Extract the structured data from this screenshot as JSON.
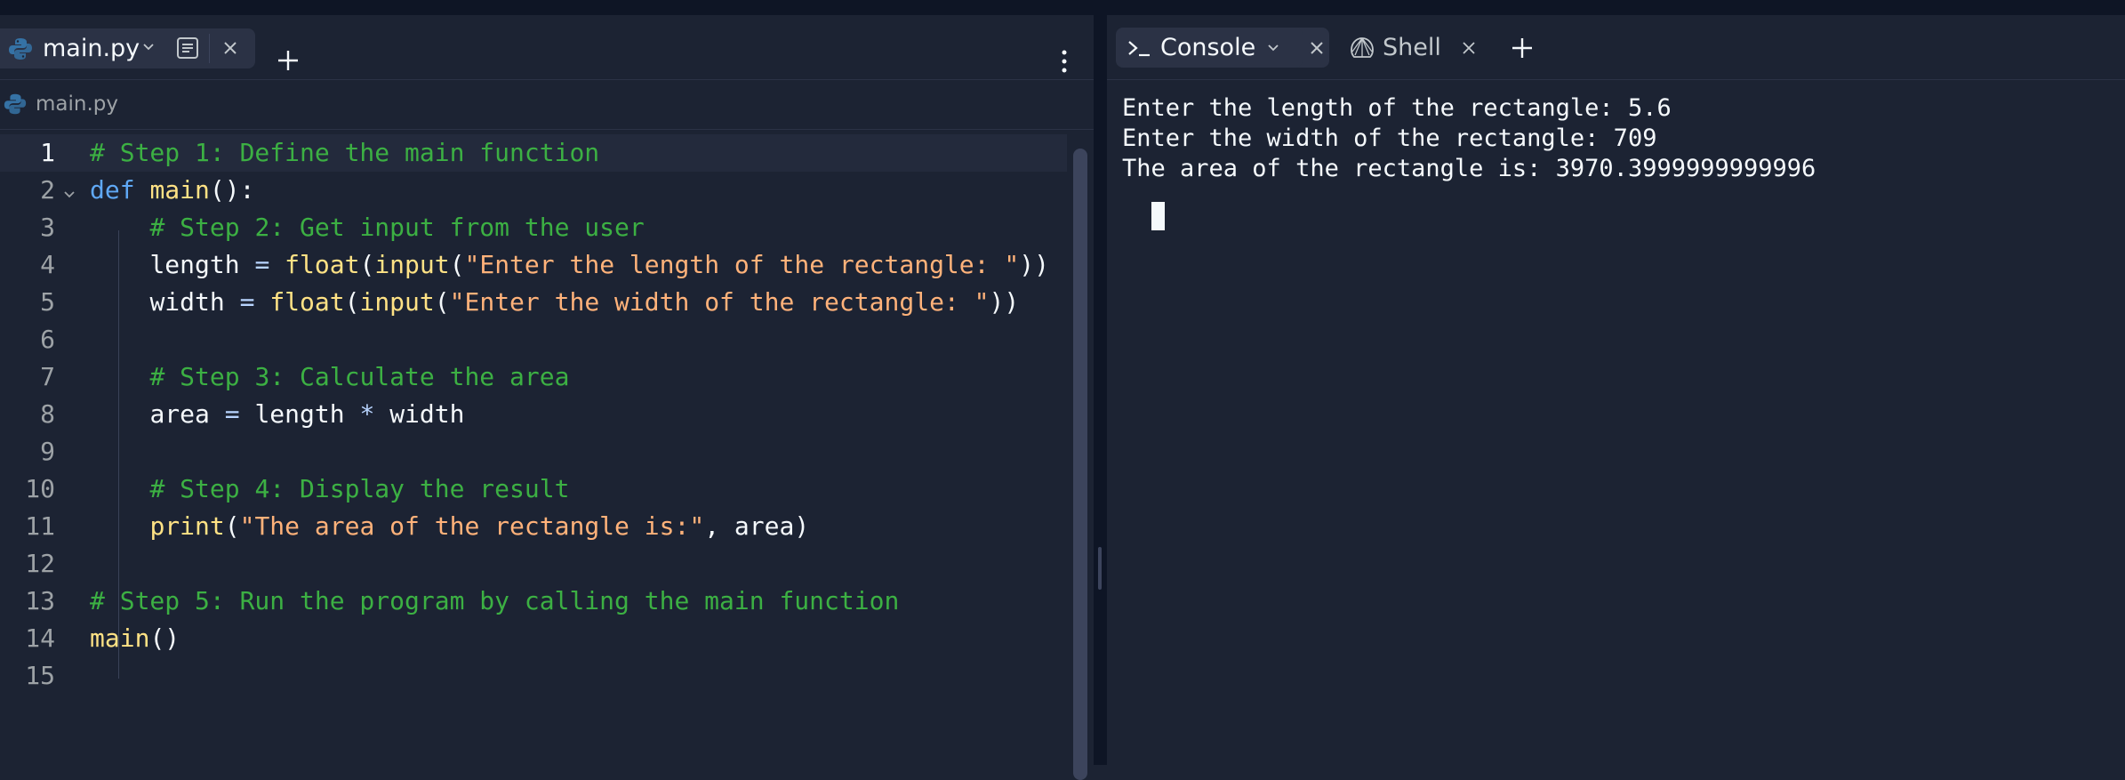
{
  "editor_tab": {
    "filename": "main.py"
  },
  "breadcrumb": {
    "filename": "main.py"
  },
  "code_lines": [
    {
      "n": "1",
      "tokens": [
        [
          "cm",
          "# Step 1: Define the main function"
        ]
      ]
    },
    {
      "n": "2",
      "tokens": [
        [
          "kw",
          "def"
        ],
        [
          "pu",
          " "
        ],
        [
          "fn",
          "main"
        ],
        [
          "pu",
          "():"
        ]
      ]
    },
    {
      "n": "3",
      "tokens": [
        [
          "pu",
          "    "
        ],
        [
          "cm",
          "# Step 2: Get input from the user"
        ]
      ]
    },
    {
      "n": "4",
      "tokens": [
        [
          "pu",
          "    "
        ],
        [
          "id",
          "length"
        ],
        [
          "pu",
          " "
        ],
        [
          "op",
          "="
        ],
        [
          "pu",
          " "
        ],
        [
          "fn",
          "float"
        ],
        [
          "pu",
          "("
        ],
        [
          "fn",
          "input"
        ],
        [
          "pu",
          "("
        ],
        [
          "st",
          "\"Enter the length of the rectangle: \""
        ],
        [
          "pu",
          "))"
        ]
      ]
    },
    {
      "n": "5",
      "tokens": [
        [
          "pu",
          "    "
        ],
        [
          "id",
          "width"
        ],
        [
          "pu",
          " "
        ],
        [
          "op",
          "="
        ],
        [
          "pu",
          " "
        ],
        [
          "fn",
          "float"
        ],
        [
          "pu",
          "("
        ],
        [
          "fn",
          "input"
        ],
        [
          "pu",
          "("
        ],
        [
          "st",
          "\"Enter the width of the rectangle: \""
        ],
        [
          "pu",
          "))"
        ]
      ]
    },
    {
      "n": "6",
      "tokens": []
    },
    {
      "n": "7",
      "tokens": [
        [
          "pu",
          "    "
        ],
        [
          "cm",
          "# Step 3: Calculate the area"
        ]
      ]
    },
    {
      "n": "8",
      "tokens": [
        [
          "pu",
          "    "
        ],
        [
          "id",
          "area"
        ],
        [
          "pu",
          " "
        ],
        [
          "op",
          "="
        ],
        [
          "pu",
          " "
        ],
        [
          "id",
          "length"
        ],
        [
          "pu",
          " "
        ],
        [
          "op",
          "*"
        ],
        [
          "pu",
          " "
        ],
        [
          "id",
          "width"
        ]
      ]
    },
    {
      "n": "9",
      "tokens": []
    },
    {
      "n": "10",
      "tokens": [
        [
          "pu",
          "    "
        ],
        [
          "cm",
          "# Step 4: Display the result"
        ]
      ]
    },
    {
      "n": "11",
      "tokens": [
        [
          "pu",
          "    "
        ],
        [
          "fn",
          "print"
        ],
        [
          "pu",
          "("
        ],
        [
          "st",
          "\"The area of the rectangle is:\""
        ],
        [
          "pu",
          ", "
        ],
        [
          "id",
          "area"
        ],
        [
          "pu",
          ")"
        ]
      ]
    },
    {
      "n": "12",
      "tokens": []
    },
    {
      "n": "13",
      "tokens": [
        [
          "cm",
          "# Step 5: Run the program by calling the main function"
        ]
      ]
    },
    {
      "n": "14",
      "tokens": [
        [
          "fn",
          "main"
        ],
        [
          "pu",
          "()"
        ]
      ]
    },
    {
      "n": "15",
      "tokens": []
    }
  ],
  "console_tab": {
    "label": "Console"
  },
  "shell_tab": {
    "label": "Shell"
  },
  "console_output": [
    "Enter the length of the rectangle: 5.6",
    "Enter the width of the rectangle: 709",
    "The area of the rectangle is: 3970.3999999999996"
  ],
  "colors": {
    "background": "#1c2333",
    "tab_active": "#2b3245",
    "comment": "#3cb043",
    "keyword": "#5fa8f5",
    "function": "#ffe285",
    "string": "#ffb27a"
  },
  "icons": [
    "python-icon",
    "chevron-down-icon",
    "document-icon",
    "close-icon",
    "plus-icon",
    "kebab-menu-icon",
    "terminal-prompt-icon",
    "shell-icon"
  ]
}
